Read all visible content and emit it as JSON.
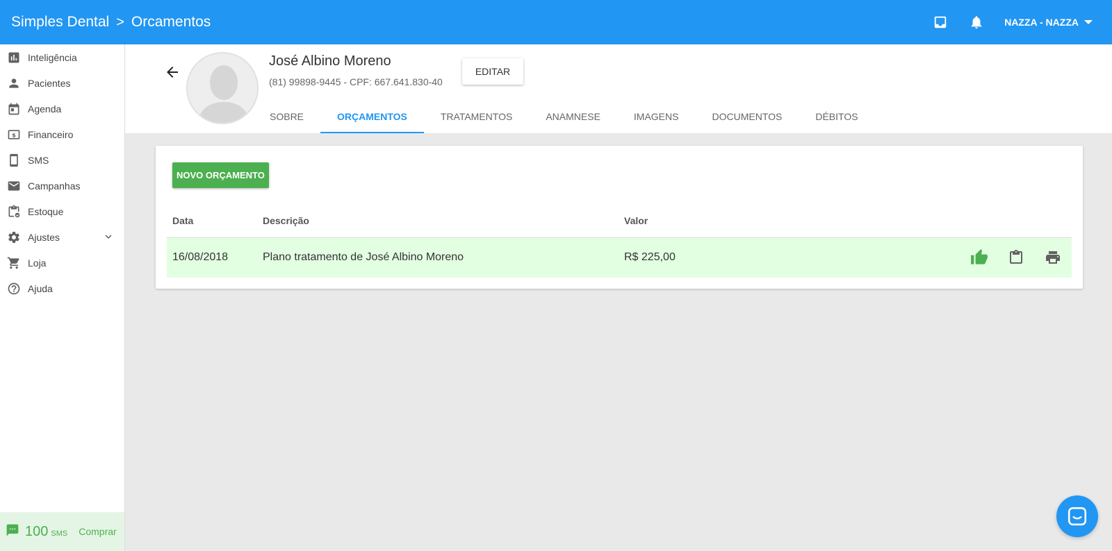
{
  "header": {
    "brand": "Simples Dental",
    "separator": ">",
    "section": "Orcamentos",
    "user": "NAZZA - NAZZA"
  },
  "sidebar": {
    "items": [
      {
        "label": "Inteligência",
        "icon": "bar-chart-icon"
      },
      {
        "label": "Pacientes",
        "icon": "person-icon"
      },
      {
        "label": "Agenda",
        "icon": "calendar-icon"
      },
      {
        "label": "Financeiro",
        "icon": "money-icon"
      },
      {
        "label": "SMS",
        "icon": "phone-icon"
      },
      {
        "label": "Campanhas",
        "icon": "mail-icon"
      },
      {
        "label": "Estoque",
        "icon": "clipboard-check-icon"
      },
      {
        "label": "Ajustes",
        "icon": "gear-icon"
      },
      {
        "label": "Loja",
        "icon": "cart-icon"
      },
      {
        "label": "Ajuda",
        "icon": "help-icon"
      }
    ],
    "sms": {
      "count": "100",
      "unit": "SMS",
      "buy": "Comprar"
    }
  },
  "patient": {
    "name": "José Albino Moreno",
    "info": "(81) 99898-9445 - CPF: 667.641.830-40",
    "edit_label": "EDITAR"
  },
  "tabs": [
    {
      "label": "SOBRE",
      "active": false
    },
    {
      "label": "ORÇAMENTOS",
      "active": true
    },
    {
      "label": "TRATAMENTOS",
      "active": false
    },
    {
      "label": "ANAMNESE",
      "active": false
    },
    {
      "label": "IMAGENS",
      "active": false
    },
    {
      "label": "DOCUMENTOS",
      "active": false
    },
    {
      "label": "DÉBITOS",
      "active": false
    }
  ],
  "budgets": {
    "new_label": "NOVO ORÇAMENTO",
    "columns": {
      "date": "Data",
      "description": "Descrição",
      "value": "Valor"
    },
    "rows": [
      {
        "date": "16/08/2018",
        "description": "Plano tratamento de José Albino Moreno",
        "value": "R$ 225,00"
      }
    ]
  },
  "colors": {
    "primary": "#2196f3",
    "success": "#4caf50",
    "row_highlight": "#e2ffe2"
  }
}
